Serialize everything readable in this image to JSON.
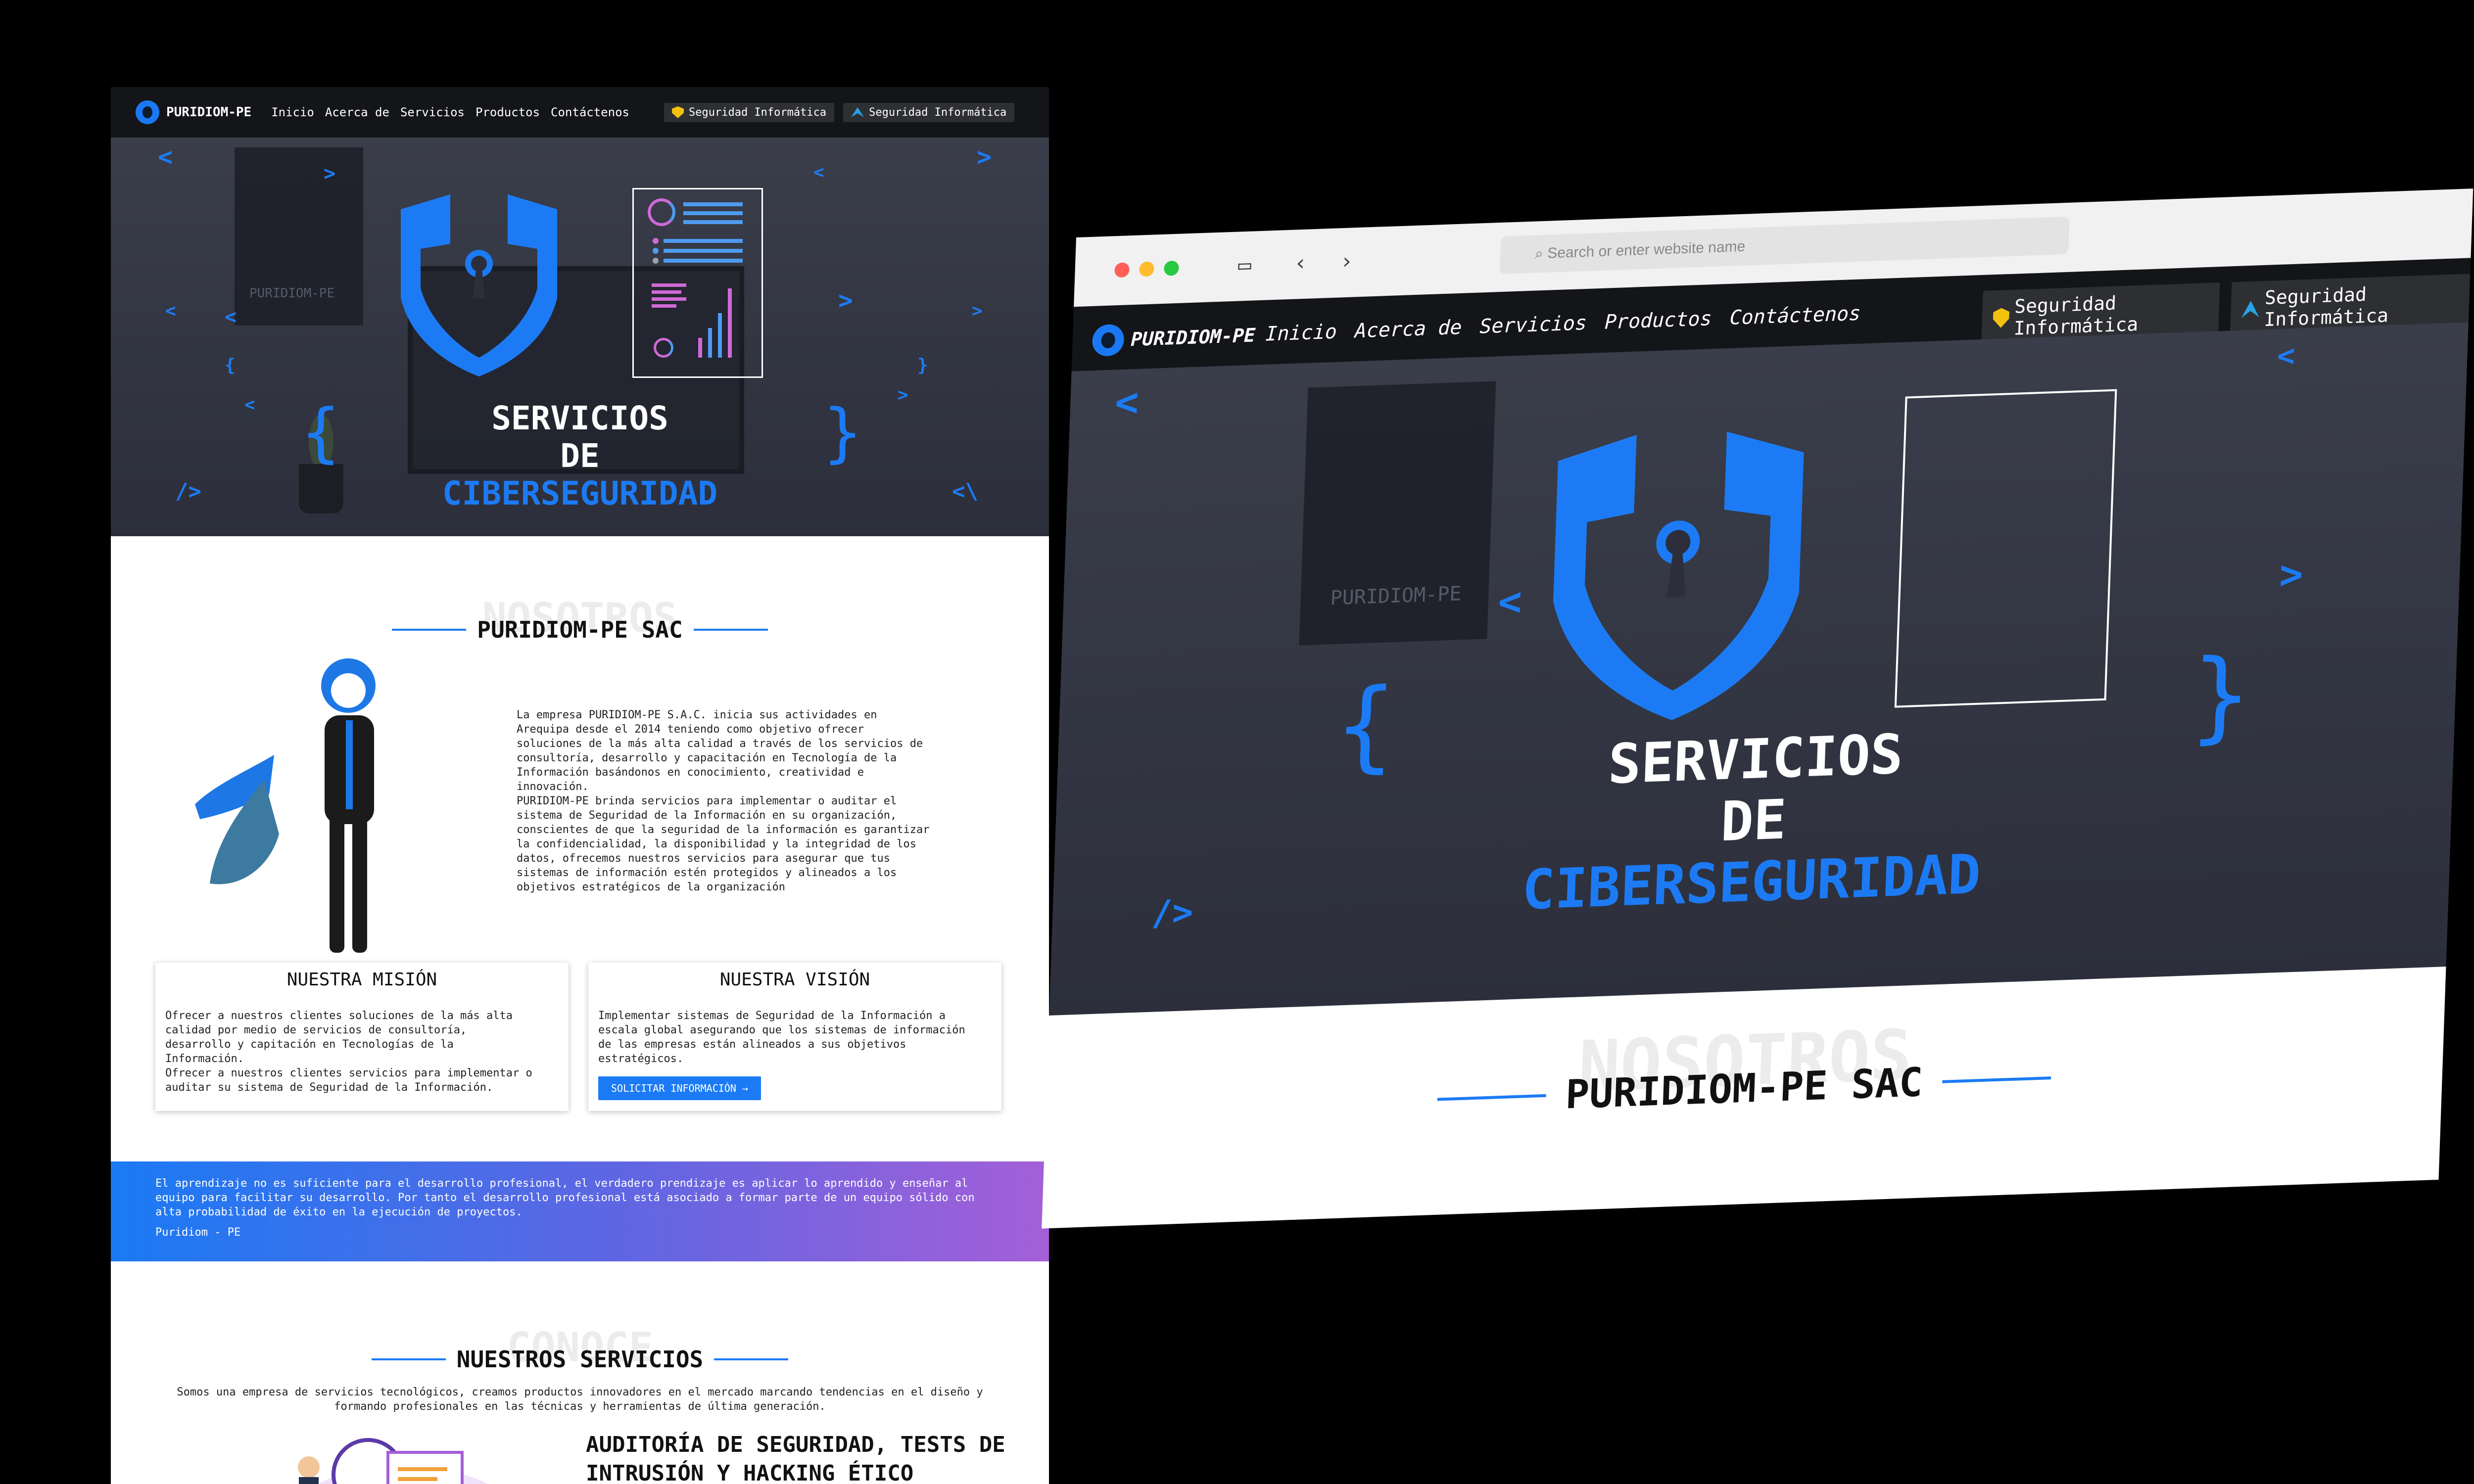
{
  "nav": {
    "brand": "PURIDIOM-PE",
    "links": [
      "Inicio",
      "Acerca de",
      "Servicios",
      "Productos",
      "Contáctenos"
    ],
    "badges": [
      "Seguridad Informática",
      "Seguridad Informática"
    ]
  },
  "hero": {
    "frame_label": "PURIDIOM-PE",
    "title_line1": "SERVICIOS",
    "title_line2": "DE",
    "title_line3": "CIBERSEGURIDAD"
  },
  "about": {
    "ghost": "NOSOTROS",
    "title": "PURIDIOM-PE SAC",
    "text": "La empresa PURIDIOM-PE S.A.C. inicia sus actividades en\nArequipa desde el 2014 teniendo como objetivo ofrecer\nsoluciones de la más alta calidad a través de los servicios de\nconsultoría, desarrollo y capacitación en Tecnología de la\nInformación basándonos en conocimiento, creatividad e\ninnovación.\nPURIDIOM-PE brinda servicios para implementar o auditar el\nsistema de Seguridad de la Información en su organización,\nconscientes de que la seguridad de la información es garantizar\nla confidencialidad, la disponibilidad y la integridad de los\ndatos, ofrecemos nuestros servicios para asegurar que tus\nsistemas de información estén protegidos y alineados a los\nobjetivos estratégicos de la organización"
  },
  "mission": {
    "title": "NUESTRA MISIÓN",
    "text": "Ofrecer a nuestros clientes soluciones de la más alta\ncalidad por medio de servicios de consultoría,\ndesarrollo y capitación en Tecnologías de la\nInformación.\nOfrecer a nuestros clientes servicios para implementar o\nauditar su sistema de Seguridad de la Información."
  },
  "vision": {
    "title": "NUESTRA VISIÓN",
    "text": "Implementar sistemas de Seguridad de la Información a\nescala global asegurando que los sistemas de información\nde las empresas están alineados a sus objetivos\nestratégicos.",
    "button": "SOLICITAR INFORMACIÓN →"
  },
  "quote": {
    "text": "El aprendizaje no es suficiente para el desarrollo profesional, el verdadero prendizaje es aplicar lo aprendido y enseñar al equipo para facilitar su desarrollo. Por tanto el desarrollo profesional está asociado a formar parte de un equipo sólido con alta probabilidad de éxito en la ejecución de proyectos.",
    "author": "Puridiom - PE"
  },
  "services": {
    "ghost": "CONOCE",
    "title": "NUESTROS SERVICIOS",
    "text": "Somos una empresa de servicios tecnológicos, creamos productos innovadores en el mercado marcando tendencias en el diseño y formando profesionales en las técnicas y herramientas de última generación.",
    "item_title": "AUDITORÍA DE SEGURIDAD, TESTS DE INTRUSIÓN Y HACKING ÉTICO"
  },
  "browser": {
    "search_placeholder": "Search or enter website name"
  },
  "colors": {
    "accent": "#1c7bf4",
    "nav_bg": "#141518",
    "hero_bg": "#33364a"
  }
}
